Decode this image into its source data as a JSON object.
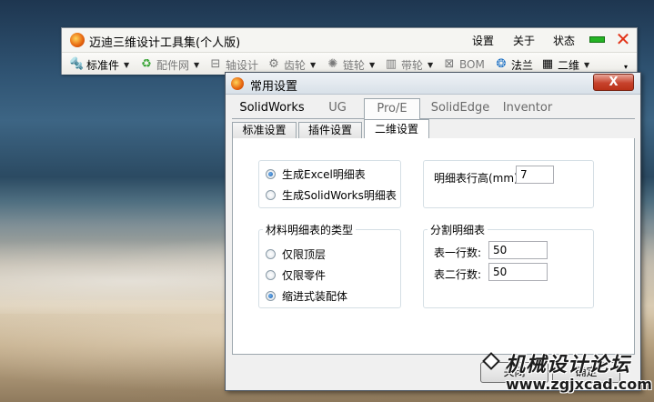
{
  "toolbar_window": {
    "title": "迈迪三维设计工具集(个人版)",
    "menu": {
      "settings": "设置",
      "about": "关于",
      "status": "状态"
    },
    "tools": [
      {
        "label": "标准件",
        "icon": "bolt-icon",
        "enabled": true
      },
      {
        "label": "配件网",
        "icon": "network-icon",
        "enabled": false
      },
      {
        "label": "轴设计",
        "icon": "shaft-icon",
        "enabled": false
      },
      {
        "label": "齿轮",
        "icon": "gear-icon",
        "enabled": false
      },
      {
        "label": "链轮",
        "icon": "sprocket-icon",
        "enabled": false
      },
      {
        "label": "带轮",
        "icon": "pulley-icon",
        "enabled": false
      },
      {
        "label": "BOM",
        "icon": "bom-icon",
        "enabled": false
      },
      {
        "label": "法兰",
        "icon": "flange-icon",
        "enabled": true
      },
      {
        "label": "二维",
        "icon": "drawing-icon",
        "enabled": true
      }
    ]
  },
  "dialog": {
    "title": "常用设置",
    "close_label": "X",
    "product_tabs": [
      "SolidWorks",
      "UG",
      "Pro/E",
      "SolidEdge",
      "Inventor"
    ],
    "sub_tabs": [
      "标准设置",
      "插件设置",
      "二维设置"
    ],
    "bom_source": {
      "options": [
        "生成Excel明细表",
        "生成SolidWorks明细表"
      ],
      "selected": 0
    },
    "row_height": {
      "label": "明细表行高(mm)",
      "value": "7"
    },
    "bom_type": {
      "label": "材料明细表的类型",
      "options": [
        "仅限顶层",
        "仅限零件",
        "缩进式装配体"
      ],
      "selected": 2
    },
    "split": {
      "label": "分割明细表",
      "table1_label": "表一行数:",
      "table1_value": "50",
      "table2_label": "表二行数:",
      "table2_value": "50"
    },
    "buttons": {
      "close": "关闭",
      "ok": "确定"
    }
  },
  "watermark": {
    "line1": "机械设计论坛",
    "line2": "www.zgjxcad.com"
  },
  "colors": {
    "accent_red": "#e23216",
    "status_green": "#24b324",
    "radio_blue": "#1b5fab"
  }
}
